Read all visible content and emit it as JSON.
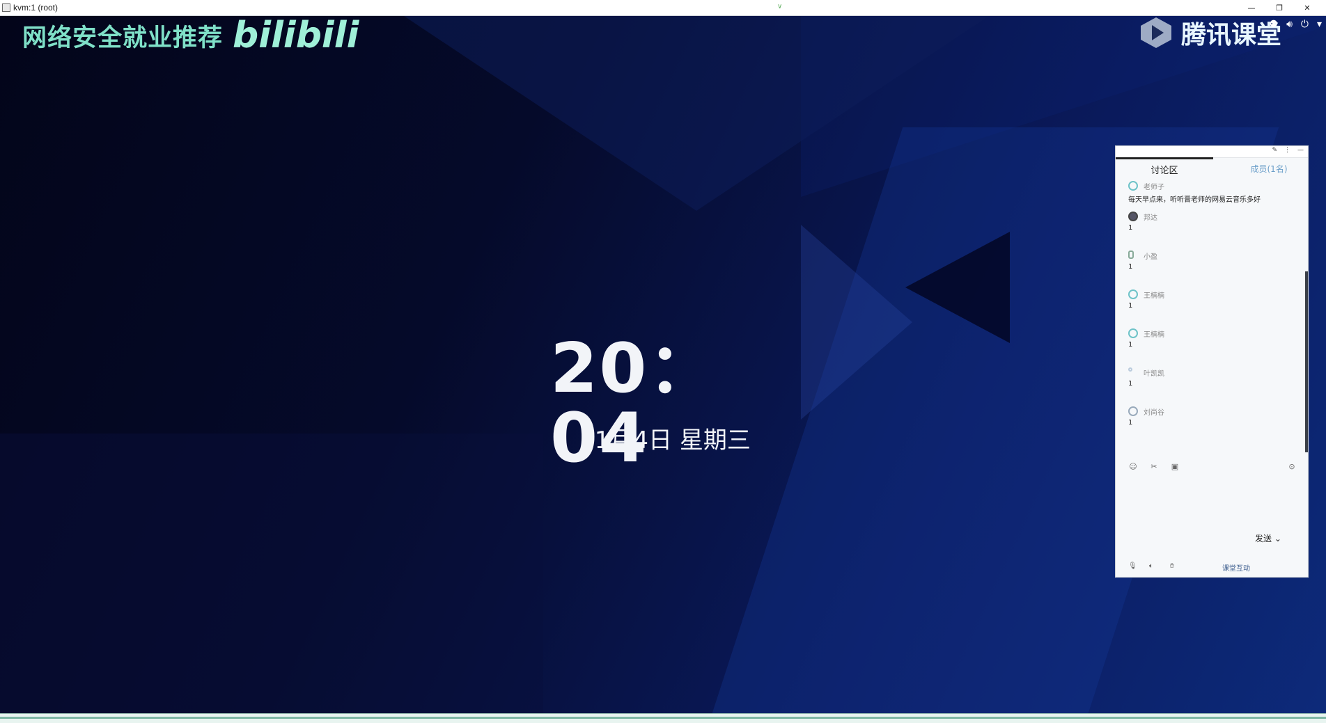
{
  "window": {
    "title": "kvm:1 (root)",
    "center_mark": "∨",
    "buttons": [
      "minimize",
      "restore",
      "close"
    ]
  },
  "watermarks": {
    "left_title": "网络安全就业推荐",
    "left_logo": "bilibili",
    "right_brand": "腾讯课堂"
  },
  "tray": {
    "icons": [
      "network-icon",
      "volume-icon",
      "power-icon"
    ]
  },
  "lock_screen": {
    "time": "20：04",
    "date": "11月4日 星期三"
  },
  "discussion_panel": {
    "active_tab": "讨论区",
    "other_tab": "成员(1名)",
    "messages": [
      {
        "user": "老师子",
        "text": "每天早点来，听听晋老师的网易云音乐多好"
      },
      {
        "user": "邦达",
        "text": "1"
      },
      {
        "user": "小盈",
        "text": "1"
      },
      {
        "user": "王楠楠",
        "text": "1"
      },
      {
        "user": "王楠楠",
        "text": "1"
      },
      {
        "user": "叶凯凯",
        "text": "1"
      },
      {
        "user": "刘尚谷",
        "text": "1"
      }
    ],
    "send_label": "发送",
    "send_dropdown": "⌄",
    "status_text": "课堂互动"
  }
}
